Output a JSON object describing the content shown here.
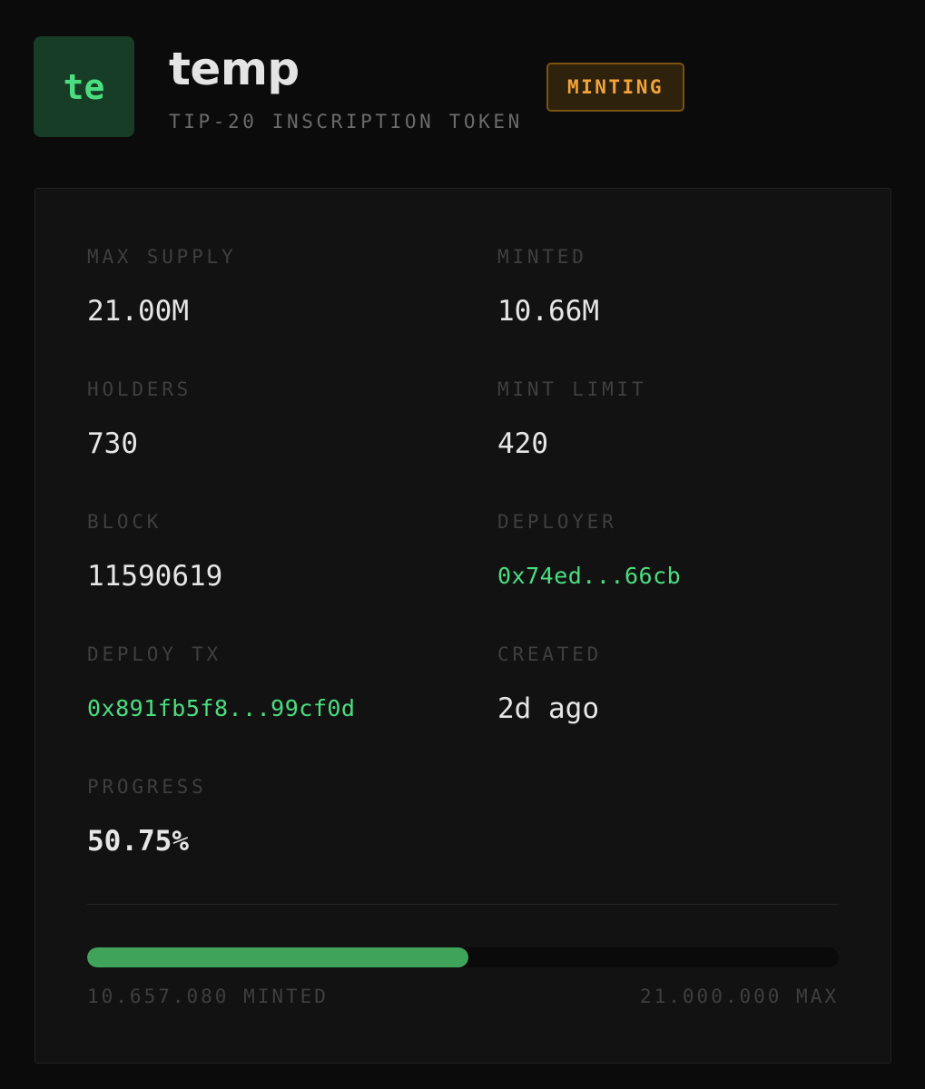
{
  "token": {
    "avatar_text": "te",
    "name": "temp",
    "subtitle": "TIP-20 INSCRIPTION TOKEN",
    "status": "MINTING"
  },
  "stats": {
    "max_supply": {
      "label": "MAX SUPPLY",
      "value": "21.00M"
    },
    "minted": {
      "label": "MINTED",
      "value": "10.66M"
    },
    "holders": {
      "label": "HOLDERS",
      "value": "730"
    },
    "mint_limit": {
      "label": "MINT LIMIT",
      "value": "420"
    },
    "block": {
      "label": "BLOCK",
      "value": "11590619"
    },
    "deployer": {
      "label": "DEPLOYER",
      "value": "0x74ed...66cb"
    },
    "deploy_tx": {
      "label": "DEPLOY TX",
      "value": "0x891fb5f8...99cf0d"
    },
    "created": {
      "label": "CREATED",
      "value": "2d ago"
    },
    "progress": {
      "label": "PROGRESS",
      "value": "50.75%"
    }
  },
  "progress_bar": {
    "fraction": 0.5075,
    "minted_text": "10.657.080 MINTED",
    "max_text": "21.000.000 MAX"
  },
  "colors": {
    "accent_green": "#4ade80",
    "progress_green": "#3fa35a",
    "status_amber": "#f2a33a"
  }
}
